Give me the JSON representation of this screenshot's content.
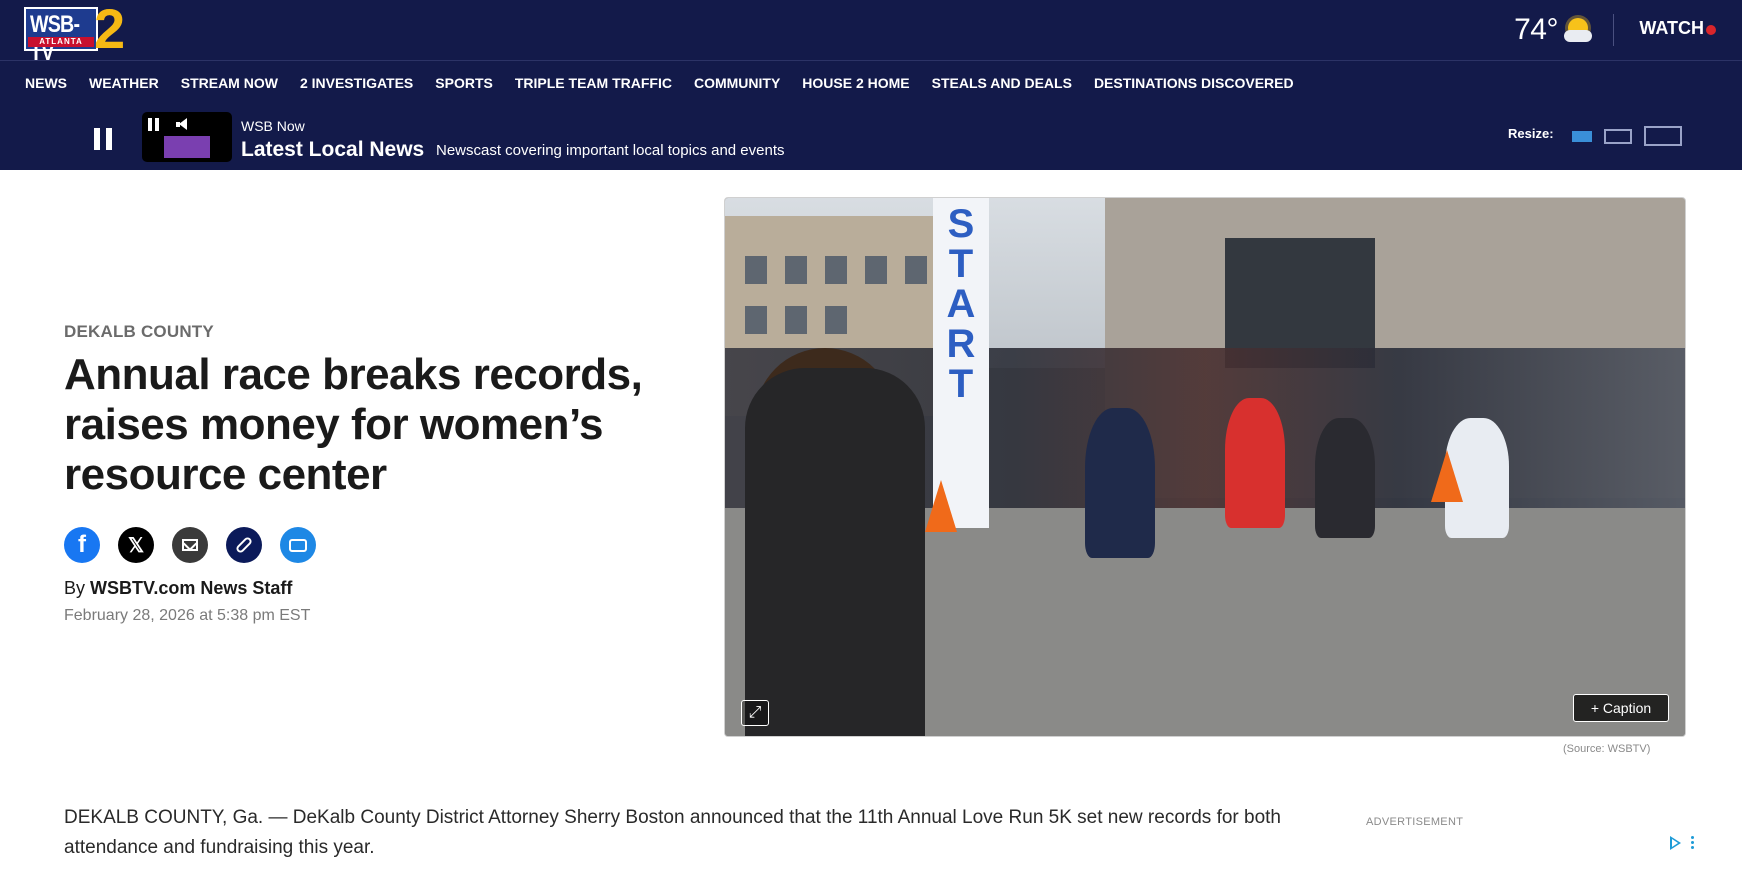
{
  "header": {
    "logo_text": "WSB-TV",
    "logo_city": "ATLANTA",
    "logo_number": "2",
    "temperature": "74°",
    "weather_icon": "partly-sunny-icon",
    "watch_label": "WATCH"
  },
  "nav": {
    "items": [
      "NEWS",
      "WEATHER",
      "STREAM NOW",
      "2 INVESTIGATES",
      "SPORTS",
      "TRIPLE TEAM TRAFFIC",
      "COMMUNITY",
      "HOUSE 2 HOME",
      "STEALS AND DEALS",
      "DESTINATIONS DISCOVERED"
    ]
  },
  "stream": {
    "label": "WSB Now",
    "title": "Latest Local News",
    "description": "Newscast covering important local topics and events",
    "resize_label": "Resize:"
  },
  "article": {
    "kicker": "DEKALB COUNTY",
    "headline": "Annual race breaks records, raises money for women’s resource center",
    "byline_prefix": "By",
    "author": "WSBTV.com News Staff",
    "date": "February 28, 2026 at 5:38 pm EST",
    "image_banner_text": "START",
    "caption_button": "+ Caption",
    "image_source": "(Source: WSBTV)",
    "body_first_paragraph": "DEKALB COUNTY, Ga. — DeKalb County District Attorney Sherry Boston announced that the 11th Annual Love Run 5K set new records for both attendance and fundraising this year."
  },
  "share": {
    "facebook_glyph": "f",
    "x_glyph": "𝕏"
  },
  "ad": {
    "label": "ADVERTISEMENT"
  },
  "colors": {
    "header_bg": "#131a4a",
    "accent_blue": "#1e88e5",
    "live_red": "#d9252b",
    "logo_gold": "#f5b914"
  }
}
